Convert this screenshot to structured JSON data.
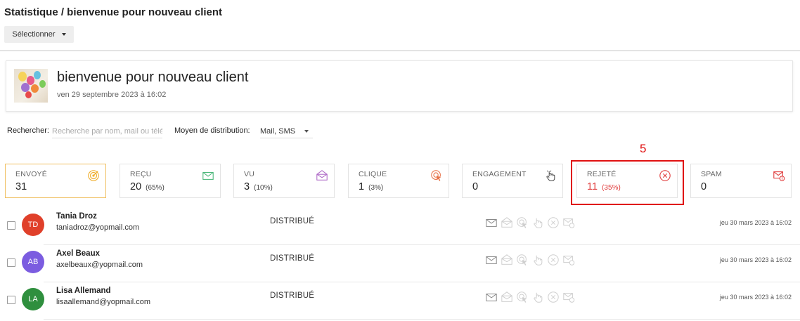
{
  "page": {
    "title": "Statistique / bienvenue pour nouveau client",
    "select_label": "Sélectionner"
  },
  "campaign": {
    "title": "bienvenue pour nouveau client",
    "date": "ven 29 septembre 2023 à 16:02"
  },
  "filters": {
    "search_label": "Rechercher:",
    "search_placeholder": "Recherche par nom, mail ou télé",
    "search_value": "",
    "distribution_label": "Moyen de distribution:",
    "distribution_value": "Mail, SMS"
  },
  "stats": [
    {
      "label": "ENVOYÉ",
      "value": "31",
      "pct": "",
      "icon": "target-icon",
      "color": "#f0b030"
    },
    {
      "label": "REÇU",
      "value": "20",
      "pct": "(65%)",
      "icon": "envelope-icon",
      "color": "#4cb87a"
    },
    {
      "label": "VU",
      "value": "3",
      "pct": "(10%)",
      "icon": "open-envelope-icon",
      "color": "#b06cc8"
    },
    {
      "label": "CLIQUE",
      "value": "1",
      "pct": "(3%)",
      "icon": "click-target-icon",
      "color": "#e8734a"
    },
    {
      "label": "ENGAGEMENT",
      "value": "0",
      "pct": "",
      "icon": "hand-pointer-icon",
      "color": "#444444"
    },
    {
      "label": "REJETÉ",
      "value": "11",
      "pct": "(35%)",
      "icon": "x-circle-icon",
      "color": "#e03b3b"
    },
    {
      "label": "SPAM",
      "value": "0",
      "pct": "",
      "icon": "spam-mail-icon",
      "color": "#e03b3b"
    }
  ],
  "annotation": {
    "number": "5"
  },
  "contacts": [
    {
      "initials": "TD",
      "avatar_color": "#e0402a",
      "name": "Tania Droz",
      "email": "taniadroz@yopmail.com",
      "status": "DISTRIBUÉ",
      "date": "jeu 30 mars 2023 à 16:02"
    },
    {
      "initials": "AB",
      "avatar_color": "#7b5ce0",
      "name": "Axel Beaux",
      "email": "axelbeaux@yopmail.com",
      "status": "DISTRIBUÉ",
      "date": "jeu 30 mars 2023 à 16:02"
    },
    {
      "initials": "LA",
      "avatar_color": "#2f8f3e",
      "name": "Lisa Allemand",
      "email": "lisaallemand@yopmail.com",
      "status": "DISTRIBUÉ",
      "date": "jeu 30 mars 2023 à 16:02"
    }
  ]
}
